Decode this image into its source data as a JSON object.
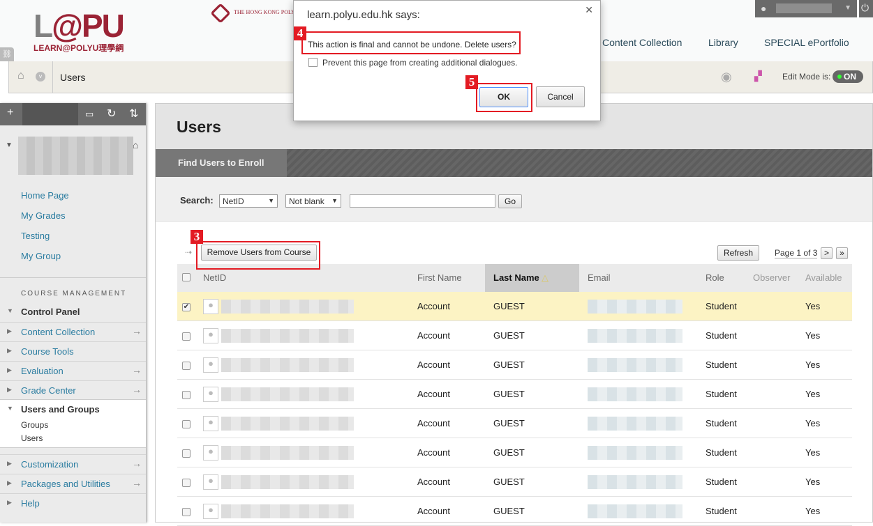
{
  "header": {
    "logo_main": "L@PU",
    "logo_sub": "LEARN@POLYU理學網",
    "university": "THE HONG KONG POLYTECHNIC UNIVERSITY 香港理工大學",
    "nav": [
      "Content Collection",
      "Library",
      "SPECIAL ePortfolio"
    ]
  },
  "breadcrumb": {
    "title": "Users",
    "edit_mode_label": "Edit Mode is:",
    "edit_mode_value": "ON"
  },
  "sidebar": {
    "links": [
      "Home Page",
      "My Grades",
      "Testing",
      "My Group"
    ],
    "section": "COURSE MANAGEMENT",
    "control_panel": "Control Panel",
    "menu": [
      {
        "label": "Content Collection",
        "arrow": true
      },
      {
        "label": "Course Tools",
        "arrow": false
      },
      {
        "label": "Evaluation",
        "arrow": true
      },
      {
        "label": "Grade Center",
        "arrow": true
      },
      {
        "label": "Users and Groups",
        "expanded": true,
        "children": [
          "Groups",
          "Users"
        ]
      },
      {
        "label": "Customization",
        "arrow": true
      },
      {
        "label": "Packages and Utilities",
        "arrow": true
      },
      {
        "label": "Help",
        "arrow": false
      }
    ]
  },
  "main": {
    "title": "Users",
    "tab": "Find Users to Enroll",
    "search_label": "Search:",
    "search_field": "NetID",
    "search_op": "Not blank",
    "search_value": "",
    "go": "Go",
    "remove_button": "Remove Users from Course",
    "refresh": "Refresh",
    "page": "Page 1 of 3",
    "next": ">",
    "last": "»",
    "columns": [
      "NetID",
      "First Name",
      "Last Name",
      "Email",
      "Role",
      "Observer",
      "Available"
    ],
    "sort_column": "Last Name",
    "rows": [
      {
        "first": "Account",
        "last": "GUEST",
        "role": "Student",
        "available": "Yes",
        "checked": true
      },
      {
        "first": "Account",
        "last": "GUEST",
        "role": "Student",
        "available": "Yes",
        "checked": false
      },
      {
        "first": "Account",
        "last": "GUEST",
        "role": "Student",
        "available": "Yes",
        "checked": false
      },
      {
        "first": "Account",
        "last": "GUEST",
        "role": "Student",
        "available": "Yes",
        "checked": false
      },
      {
        "first": "Account",
        "last": "GUEST",
        "role": "Student",
        "available": "Yes",
        "checked": false
      },
      {
        "first": "Account",
        "last": "GUEST",
        "role": "Student",
        "available": "Yes",
        "checked": false
      },
      {
        "first": "Account",
        "last": "GUEST",
        "role": "Student",
        "available": "Yes",
        "checked": false
      },
      {
        "first": "Account",
        "last": "GUEST",
        "role": "Student",
        "available": "Yes",
        "checked": false
      }
    ]
  },
  "dialog": {
    "title": "learn.polyu.edu.hk says:",
    "message": "This action is final and cannot be undone. Delete users?",
    "prevent": "Prevent this page from creating additional dialogues.",
    "ok": "OK",
    "cancel": "Cancel"
  },
  "annotations": [
    "3",
    "4",
    "5"
  ],
  "colors": {
    "accent": "#9b2335",
    "link": "#2a7ca0",
    "highlight": "#e31b23",
    "selected_row": "#fcf3c4"
  }
}
